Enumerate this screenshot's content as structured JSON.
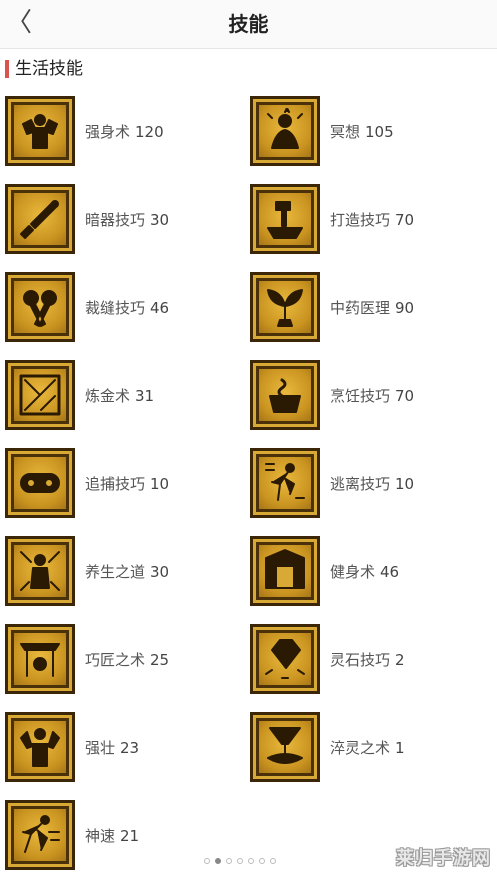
{
  "header": {
    "back_icon": "chevron-left-icon",
    "back_glyph": "〈",
    "title": "技能"
  },
  "section": {
    "title": "生活技能",
    "accent": "#d9534f"
  },
  "skills": [
    {
      "name": "强身术",
      "value": "120",
      "icon": "muscle-icon"
    },
    {
      "name": "冥想",
      "value": "105",
      "icon": "meditation-icon"
    },
    {
      "name": "暗器技巧",
      "value": "30",
      "icon": "dagger-icon"
    },
    {
      "name": "打造技巧",
      "value": "70",
      "icon": "hammer-anvil-icon"
    },
    {
      "name": "裁缝技巧",
      "value": "46",
      "icon": "scissors-icon"
    },
    {
      "name": "中药医理",
      "value": "90",
      "icon": "herb-icon"
    },
    {
      "name": "炼金术",
      "value": "31",
      "icon": "alchemy-icon"
    },
    {
      "name": "烹饪技巧",
      "value": "70",
      "icon": "cooking-pot-icon"
    },
    {
      "name": "追捕技巧",
      "value": "10",
      "icon": "shackle-icon"
    },
    {
      "name": "逃离技巧",
      "value": "10",
      "icon": "running-man-icon"
    },
    {
      "name": "养生之道",
      "value": "30",
      "icon": "health-icon"
    },
    {
      "name": "健身术",
      "value": "46",
      "icon": "gate-icon"
    },
    {
      "name": "巧匠之术",
      "value": "25",
      "icon": "workshop-icon"
    },
    {
      "name": "灵石技巧",
      "value": "2",
      "icon": "gem-icon"
    },
    {
      "name": "强壮",
      "value": "23",
      "icon": "strongman-icon"
    },
    {
      "name": "淬灵之术",
      "value": "1",
      "icon": "cauldron-icon"
    },
    {
      "name": "神速",
      "value": "21",
      "icon": "speed-icon"
    }
  ],
  "pager": {
    "count": 7,
    "active": 1
  },
  "watermark": "莱归手游网",
  "colors": {
    "icon_gold": "#d9a935",
    "icon_dark": "#3b2707"
  }
}
